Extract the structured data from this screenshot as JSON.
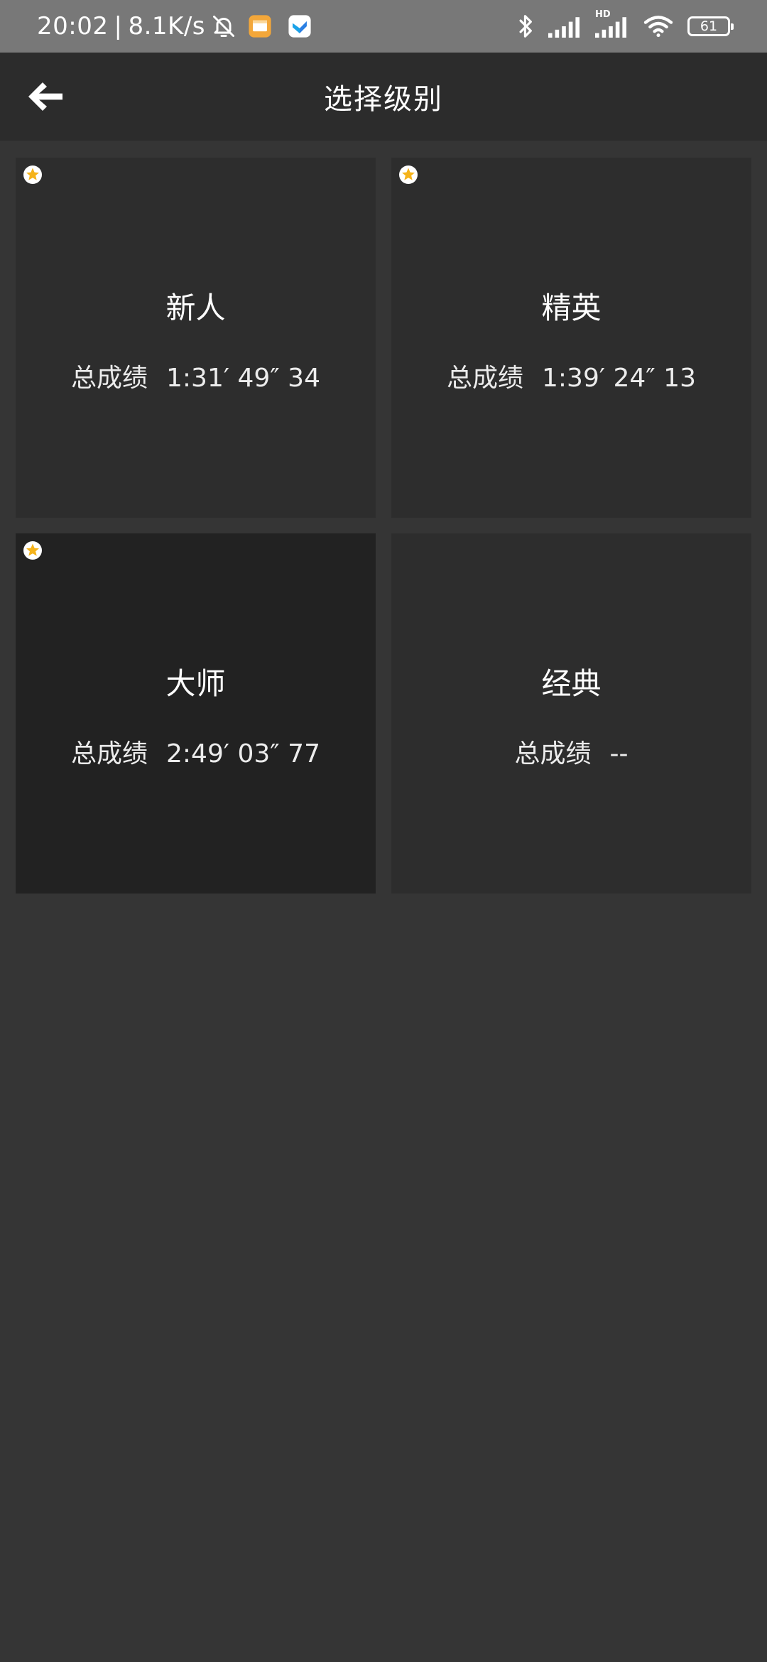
{
  "status_bar": {
    "time": "20:02",
    "separator": "|",
    "net_speed": "8.1K/s",
    "signal_hd_label": "HD",
    "battery": "61",
    "icons": [
      "bell-off-icon",
      "gallery-app-icon",
      "maps-app-icon",
      "bluetooth-icon",
      "signal-icon",
      "signal-hd-icon",
      "wifi-icon",
      "battery-icon"
    ]
  },
  "app_bar": {
    "title": "选择级别",
    "back_icon": "arrow-left-icon"
  },
  "colors": {
    "status_bar_bg": "#787878",
    "app_bar_bg": "#2c2c2c",
    "page_bg": "#353535",
    "card_bg": "#2d2d2d",
    "card_selected_bg": "#222222",
    "star": "#f5b31a"
  },
  "levels": [
    {
      "name": "新人",
      "score_label": "总成绩",
      "score": "1:31′ 49″ 34",
      "starred": true,
      "selected": false
    },
    {
      "name": "精英",
      "score_label": "总成绩",
      "score": "1:39′ 24″ 13",
      "starred": true,
      "selected": false
    },
    {
      "name": "大师",
      "score_label": "总成绩",
      "score": "2:49′ 03″ 77",
      "starred": true,
      "selected": true
    },
    {
      "name": "经典",
      "score_label": "总成绩",
      "score": "--",
      "starred": false,
      "selected": false
    }
  ]
}
